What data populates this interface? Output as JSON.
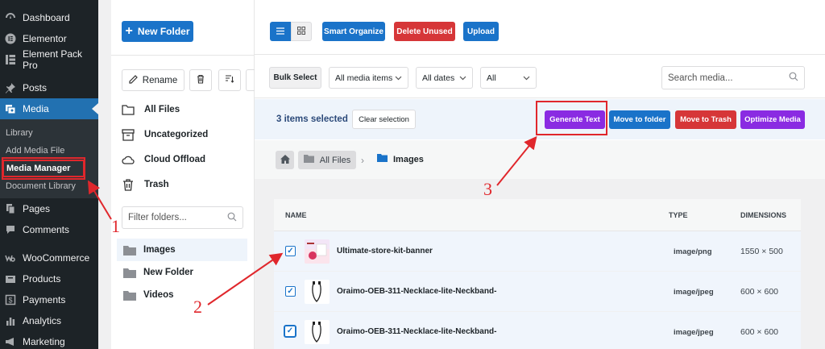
{
  "sidebar": {
    "items_top": [
      {
        "label": "Dashboard",
        "icon": "dashboard-icon"
      },
      {
        "label": "Elementor",
        "icon": "elementor-icon"
      },
      {
        "label": "Element Pack Pro",
        "icon": "element-pack-icon"
      },
      {
        "label": "Posts",
        "icon": "pin-icon"
      },
      {
        "label": "Media",
        "icon": "media-icon"
      }
    ],
    "media_sub": [
      "Library",
      "Add Media File",
      "Media Manager",
      "Document Library"
    ],
    "items_bottom": [
      {
        "label": "Pages",
        "icon": "pages-icon"
      },
      {
        "label": "Comments",
        "icon": "comments-icon"
      },
      {
        "label": "WooCommerce",
        "icon": "woo-icon"
      },
      {
        "label": "Products",
        "icon": "products-icon"
      },
      {
        "label": "Payments",
        "icon": "payments-icon"
      },
      {
        "label": "Analytics",
        "icon": "analytics-icon"
      },
      {
        "label": "Marketing",
        "icon": "marketing-icon"
      }
    ]
  },
  "folders": {
    "new_folder_label": "New Folder",
    "rename_label": "Rename",
    "system": [
      "All Files",
      "Uncategorized",
      "Cloud Offload",
      "Trash"
    ],
    "filter_placeholder": "Filter folders...",
    "tree": [
      "Images",
      "New Folder",
      "Videos"
    ]
  },
  "toolbar": {
    "smart_organize": "Smart Organize",
    "delete_unused": "Delete Unused",
    "upload": "Upload"
  },
  "filters": {
    "bulk_select": "Bulk Select",
    "media_items": "All media items",
    "dates": "All dates",
    "all": "All",
    "search_placeholder": "Search media..."
  },
  "actions": {
    "items_selected": "3 items selected",
    "clear_selection": "Clear selection",
    "generate_text": "Generate Text",
    "move_to_folder": "Move to folder",
    "move_to_trash": "Move to Trash",
    "optimize_media": "Optimize Media"
  },
  "breadcrumb": {
    "all_files": "All Files",
    "current": "Images"
  },
  "table": {
    "headers": {
      "name": "NAME",
      "type": "TYPE",
      "dimensions": "DIMENSIONS"
    },
    "rows": [
      {
        "name": "Ultimate-store-kit-banner",
        "type": "image/png",
        "dimensions": "1550 × 500"
      },
      {
        "name": "Oraimo-OEB-311-Necklace-lite-Neckband-",
        "type": "image/jpeg",
        "dimensions": "600 × 600"
      },
      {
        "name": "Oraimo-OEB-311-Necklace-lite-Neckband-",
        "type": "image/jpeg",
        "dimensions": "600 × 600"
      }
    ]
  },
  "annotations": [
    "1",
    "2",
    "3"
  ],
  "colors": {
    "primary": "#1a73c9",
    "danger": "#e0272c",
    "purple": "#8a2be2",
    "sidebar_bg": "#1d2327"
  }
}
